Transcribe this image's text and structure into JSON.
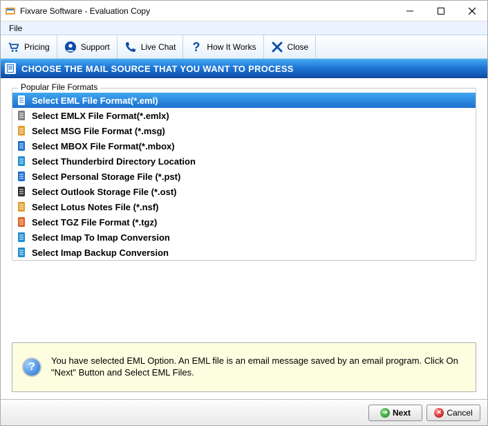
{
  "window": {
    "title": "Fixvare Software - Evaluation Copy"
  },
  "menubar": {
    "file": "File"
  },
  "toolbar": {
    "pricing": "Pricing",
    "support": "Support",
    "livechat": "Live Chat",
    "howitworks": "How It Works",
    "close": "Close"
  },
  "header": {
    "title": "CHOOSE THE MAIL SOURCE THAT YOU WANT TO PROCESS"
  },
  "fieldset": {
    "legend": "Popular File Formats",
    "items": [
      {
        "label": "Select EML File Format(*.eml)",
        "selected": true,
        "iconColor": "#1d6fd0"
      },
      {
        "label": "Select EMLX File Format(*.emlx)",
        "selected": false,
        "iconColor": "#808080"
      },
      {
        "label": "Select MSG File Format (*.msg)",
        "selected": false,
        "iconColor": "#e0a030"
      },
      {
        "label": "Select MBOX File Format(*.mbox)",
        "selected": false,
        "iconColor": "#1d6fd0"
      },
      {
        "label": "Select Thunderbird Directory Location",
        "selected": false,
        "iconColor": "#1d8fd0"
      },
      {
        "label": "Select Personal Storage File (*.pst)",
        "selected": false,
        "iconColor": "#1d6fd0"
      },
      {
        "label": "Select Outlook Storage File (*.ost)",
        "selected": false,
        "iconColor": "#303030"
      },
      {
        "label": "Select Lotus Notes File (*.nsf)",
        "selected": false,
        "iconColor": "#e0a030"
      },
      {
        "label": "Select TGZ File Format (*.tgz)",
        "selected": false,
        "iconColor": "#e06020"
      },
      {
        "label": "Select Imap To Imap Conversion",
        "selected": false,
        "iconColor": "#1d8fd0"
      },
      {
        "label": "Select Imap Backup Conversion",
        "selected": false,
        "iconColor": "#1d8fd0"
      }
    ]
  },
  "info": {
    "text": "You have selected EML Option. An EML file is an email message saved by an email program. Click On \"Next\" Button and Select EML Files."
  },
  "footer": {
    "next": "Next",
    "cancel": "Cancel"
  }
}
